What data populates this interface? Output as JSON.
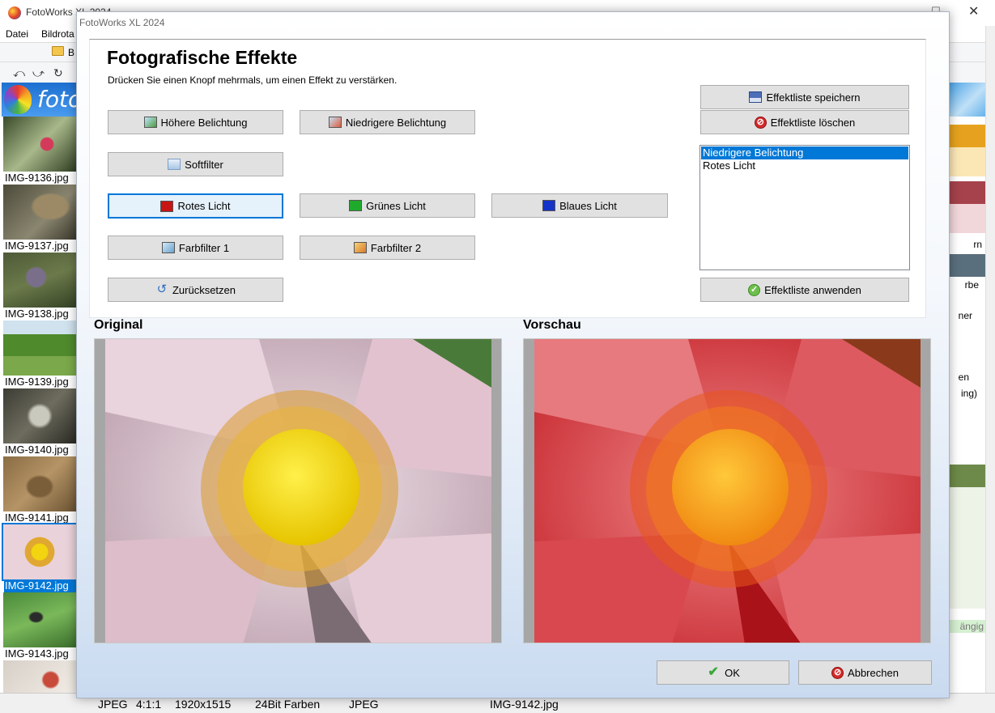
{
  "main_window": {
    "title": "FotoWorks XL 2024",
    "menu": [
      "Datei",
      "Bildrota"
    ],
    "toolbar_folder_label": "B",
    "logo_text": "foto"
  },
  "thumbnails": [
    {
      "label": "IMG-9136.jpg",
      "selected": false
    },
    {
      "label": "IMG-9137.jpg",
      "selected": false
    },
    {
      "label": "IMG-9138.jpg",
      "selected": false
    },
    {
      "label": "IMG-9139.jpg",
      "selected": false
    },
    {
      "label": "IMG-9140.jpg",
      "selected": false
    },
    {
      "label": "IMG-9141.jpg",
      "selected": false
    },
    {
      "label": "IMG-9142.jpg",
      "selected": true
    },
    {
      "label": "IMG-9143.jpg",
      "selected": false
    }
  ],
  "right_panel_fragments": [
    "rn",
    "rbe",
    "ner",
    "en",
    "ing)",
    "ängig"
  ],
  "statusbar": {
    "format": "JPEG",
    "subsampling": "4:1:1",
    "dimensions": "1920x1515",
    "color_depth": "24Bit Farben",
    "type": "JPEG",
    "filename": "IMG-9142.jpg"
  },
  "dialog": {
    "title": "FotoWorks XL 2024",
    "heading": "Fotografische Effekte",
    "hint": "Drücken Sie einen Knopf mehrmals, um einen Effekt zu verstärken.",
    "buttons": {
      "brighter": "Höhere Belichtung",
      "darker": "Niedrigere Belichtung",
      "softfilter": "Softfilter",
      "red_light": "Rotes Licht",
      "green_light": "Grünes Licht",
      "blue_light": "Blaues Licht",
      "colorfilter1": "Farbfilter 1",
      "colorfilter2": "Farbfilter 2",
      "reset": "Zurücksetzen",
      "save_list": "Effektliste speichern",
      "delete_list": "Effektliste löschen",
      "apply_list": "Effektliste anwenden",
      "ok": "OK",
      "cancel": "Abbrechen"
    },
    "effect_list": [
      {
        "label": "Niedrigere Belichtung",
        "selected": true
      },
      {
        "label": "Rotes Licht",
        "selected": false
      }
    ],
    "original_label": "Original",
    "preview_label": "Vorschau"
  },
  "colors": {
    "selection": "#0078d7",
    "button_face": "#e1e1e1",
    "red_light": "#c81414",
    "green_light": "#1faa2c",
    "blue_light": "#1633c8"
  }
}
